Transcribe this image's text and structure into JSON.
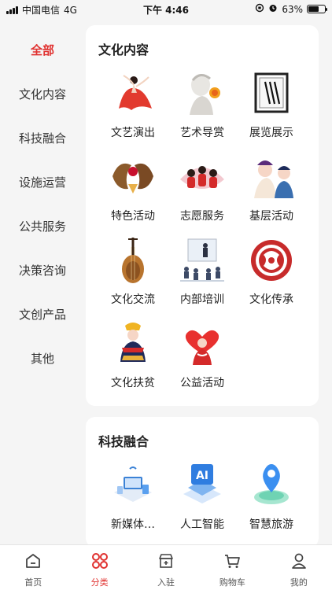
{
  "status_bar": {
    "carrier": "中国电信",
    "network": "4G",
    "time": "下午 4:46",
    "battery_percent": "63%",
    "battery_level": 0.63
  },
  "sidebar": {
    "items": [
      {
        "label": "全部",
        "active": true
      },
      {
        "label": "文化内容"
      },
      {
        "label": "科技融合"
      },
      {
        "label": "设施运营"
      },
      {
        "label": "公共服务"
      },
      {
        "label": "决策咨询"
      },
      {
        "label": "文创产品"
      },
      {
        "label": "其他"
      }
    ]
  },
  "sections": [
    {
      "title": "文化内容",
      "items": [
        {
          "label": "文艺演出",
          "icon": "dancer-icon"
        },
        {
          "label": "艺术导赏",
          "icon": "sculpture-icon"
        },
        {
          "label": "展览展示",
          "icon": "frame-icon"
        },
        {
          "label": "特色活动",
          "icon": "lion-dance-icon"
        },
        {
          "label": "志愿服务",
          "icon": "volunteers-icon"
        },
        {
          "label": "基层活动",
          "icon": "opera-icon"
        },
        {
          "label": "文化交流",
          "icon": "pipa-icon"
        },
        {
          "label": "内部培训",
          "icon": "training-icon"
        },
        {
          "label": "文化传承",
          "icon": "paper-cut-icon"
        },
        {
          "label": "文化扶贫",
          "icon": "ethnic-figure-icon"
        },
        {
          "label": "公益活动",
          "icon": "heart-charity-icon"
        }
      ]
    },
    {
      "title": "科技融合",
      "items": [
        {
          "label": "新媒体…",
          "icon": "new-media-icon"
        },
        {
          "label": "人工智能",
          "icon": "ai-icon"
        },
        {
          "label": "智慧旅游",
          "icon": "smart-tourism-icon"
        }
      ]
    }
  ],
  "tabbar": {
    "items": [
      {
        "label": "首页",
        "icon": "home-icon"
      },
      {
        "label": "分类",
        "icon": "category-icon",
        "active": true
      },
      {
        "label": "入驻",
        "icon": "store-icon"
      },
      {
        "label": "购物车",
        "icon": "cart-icon"
      },
      {
        "label": "我的",
        "icon": "profile-icon"
      }
    ]
  },
  "colors": {
    "accent": "#e0312f",
    "background": "#f5f5f5",
    "card": "#ffffff"
  }
}
